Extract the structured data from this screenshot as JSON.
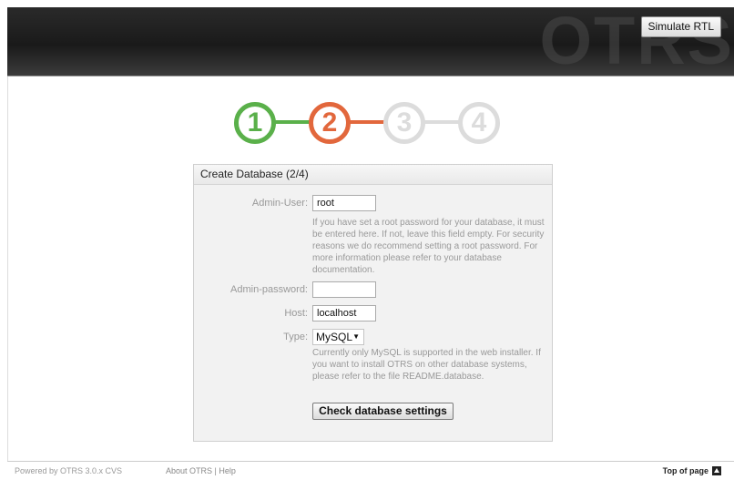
{
  "header": {
    "logo_text": "OTRS",
    "simulate_rtl_label": "Simulate RTL"
  },
  "steps": [
    "1",
    "2",
    "3",
    "4"
  ],
  "panel": {
    "title": "Create Database (2/4)",
    "admin_user": {
      "label": "Admin-User:",
      "value": "root",
      "description": "If you have set a root password for your database, it must be entered here. If not, leave this field empty. For security reasons we do recommend setting a root password. For more information please refer to your database documentation."
    },
    "admin_password": {
      "label": "Admin-password:",
      "value": ""
    },
    "host": {
      "label": "Host:",
      "value": "localhost"
    },
    "type": {
      "label": "Type:",
      "selected": "MySQL",
      "description": "Currently only MySQL is supported in the web installer. If you want to install OTRS on other database systems, please refer to the file README.database."
    },
    "check_button_label": "Check database settings"
  },
  "footer": {
    "powered_by": "Powered by OTRS 3.0.x CVS",
    "about": "About OTRS",
    "separator": "|",
    "help": "Help",
    "top_of_page": "Top of page"
  },
  "colors": {
    "step_done": "#5ab04a",
    "step_current": "#e2673c",
    "step_todo": "#dcdcdc"
  }
}
